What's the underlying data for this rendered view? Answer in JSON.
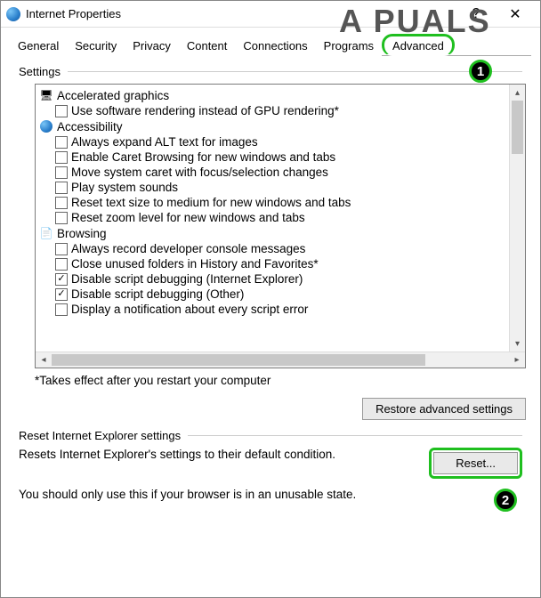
{
  "window": {
    "title": "Internet Properties",
    "help": "?",
    "close": "✕"
  },
  "watermark": "A PUALS",
  "tabs": [
    "General",
    "Security",
    "Privacy",
    "Content",
    "Connections",
    "Programs",
    "Advanced"
  ],
  "settings": {
    "label": "Settings",
    "groups": [
      {
        "icon": "monitor",
        "label": "Accelerated graphics",
        "items": [
          {
            "checked": false,
            "label": "Use software rendering instead of GPU rendering*"
          }
        ]
      },
      {
        "icon": "globe",
        "label": "Accessibility",
        "items": [
          {
            "checked": false,
            "label": "Always expand ALT text for images"
          },
          {
            "checked": false,
            "label": "Enable Caret Browsing for new windows and tabs"
          },
          {
            "checked": false,
            "label": "Move system caret with focus/selection changes"
          },
          {
            "checked": false,
            "label": "Play system sounds"
          },
          {
            "checked": false,
            "label": "Reset text size to medium for new windows and tabs"
          },
          {
            "checked": false,
            "label": "Reset zoom level for new windows and tabs"
          }
        ]
      },
      {
        "icon": "doc",
        "label": "Browsing",
        "items": [
          {
            "checked": false,
            "label": "Always record developer console messages"
          },
          {
            "checked": false,
            "label": "Close unused folders in History and Favorites*"
          },
          {
            "checked": true,
            "label": "Disable script debugging (Internet Explorer)"
          },
          {
            "checked": true,
            "label": "Disable script debugging (Other)"
          },
          {
            "checked": false,
            "label": "Display a notification about every script error"
          }
        ]
      }
    ],
    "note": "*Takes effect after you restart your computer",
    "restore_btn": "Restore advanced settings"
  },
  "reset": {
    "label": "Reset Internet Explorer settings",
    "desc": "Resets Internet Explorer's settings to their default condition.",
    "btn": "Reset...",
    "warn": "You should only use this if your browser is in an unusable state."
  },
  "callouts": {
    "one": "1",
    "two": "2"
  }
}
